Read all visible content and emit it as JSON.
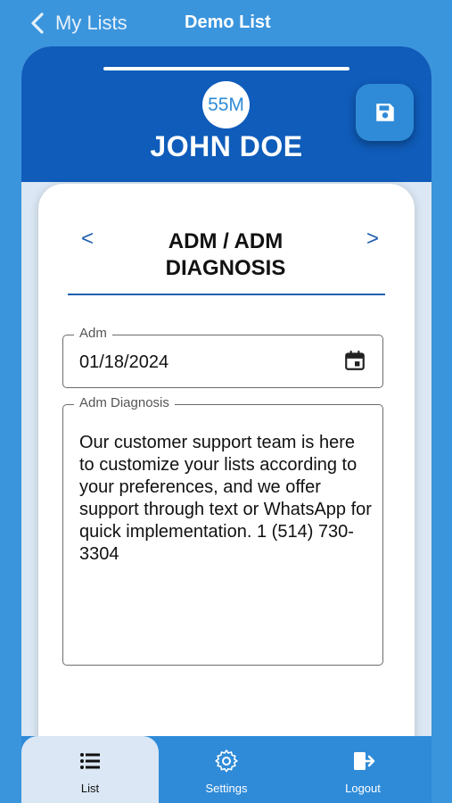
{
  "nav": {
    "back_label": "My Lists",
    "title": "Demo List"
  },
  "patient": {
    "avatar_text": "55M",
    "name": "JOHN DOE"
  },
  "section": {
    "title": "ADM / ADM DIAGNOSIS",
    "prev_arrow": "<",
    "next_arrow": ">"
  },
  "fields": {
    "adm": {
      "label": "Adm",
      "value": "01/18/2024"
    },
    "adm_diagnosis": {
      "label": "Adm Diagnosis",
      "value": "Our customer support team is here to customize your lists according to your preferences, and we offer support through text or WhatsApp for quick implementation. 1 (514) 730-3304"
    }
  },
  "tabs": [
    {
      "label": "List",
      "icon": "list-icon",
      "active": true
    },
    {
      "label": "Settings",
      "icon": "gear-icon",
      "active": false
    },
    {
      "label": "Logout",
      "icon": "logout-icon",
      "active": false
    }
  ],
  "colors": {
    "background": "#3b95dd",
    "header": "#0f5cba",
    "accent": "#2f8bd8",
    "underline": "#1f5fb0"
  }
}
